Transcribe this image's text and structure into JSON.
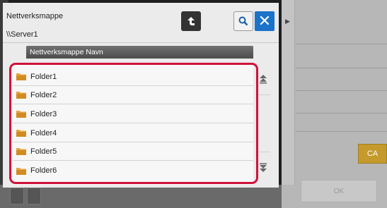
{
  "dialog": {
    "title": "Nettverksmappe",
    "path": "\\\\Server1",
    "column_header": "Nettverksmappe Navn",
    "folders": [
      {
        "label": "Folder1"
      },
      {
        "label": "Folder2"
      },
      {
        "label": "Folder3"
      },
      {
        "label": "Folder4"
      },
      {
        "label": "Folder5"
      },
      {
        "label": "Folder6"
      }
    ],
    "close_glyph": "✕"
  },
  "side_panel": {
    "ca_label": "CA",
    "ok_label": "OK"
  },
  "colors": {
    "accent_blue": "#1a72c9",
    "highlight_red": "#d0123b",
    "ca_orange": "#c49a2c",
    "folder_orange": "#e6a640"
  },
  "icons": {
    "up": "folder-up-icon",
    "search": "search-icon",
    "close": "close-icon",
    "folder": "folder-icon",
    "scroll_up": "scroll-up-icon",
    "scroll_down": "scroll-down-icon",
    "expand": "expand-panel-icon"
  }
}
